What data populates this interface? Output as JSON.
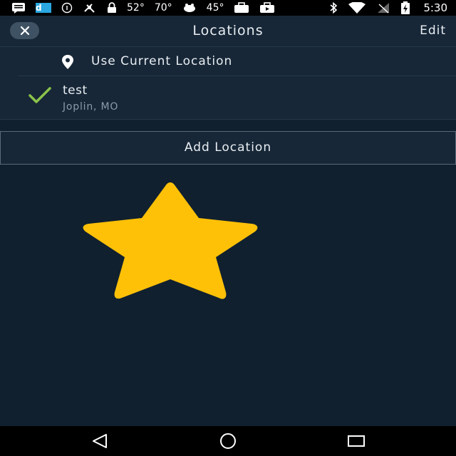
{
  "status_bar": {
    "temps": [
      "52°",
      "70°",
      "45°"
    ],
    "time": "5:30",
    "icons": [
      "message-icon",
      "d-app-icon",
      "info-icon",
      "satellite-icon",
      "lock-icon",
      "weather-icon",
      "briefcase-icon",
      "bluetooth-icon",
      "wifi-icon",
      "no-signal-icon",
      "battery-icon"
    ]
  },
  "header": {
    "title": "Locations",
    "edit_label": "Edit"
  },
  "locations": {
    "current_label": "Use Current Location",
    "items": [
      {
        "name": "test",
        "subtitle": "Joplin, MO",
        "selected": true
      }
    ]
  },
  "add_location_label": "Add Location",
  "colors": {
    "background": "#10202f",
    "panel": "#172737",
    "accent_check": "#8bc34a",
    "star": "#ffc107"
  }
}
